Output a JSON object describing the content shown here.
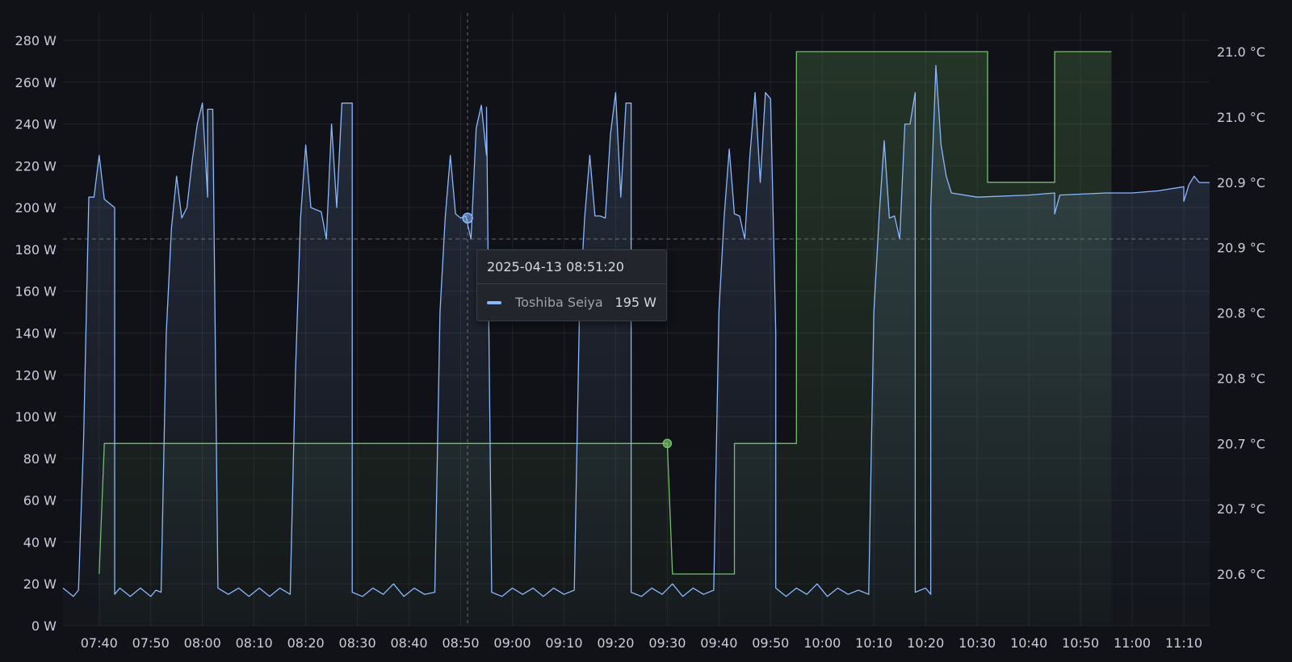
{
  "chart_data": {
    "type": "line",
    "title": "",
    "xlabel": "",
    "ylabel": "",
    "xlim_minutes": [
      "07:33",
      "11:15"
    ],
    "x_ticks": [
      "07:40",
      "07:50",
      "08:00",
      "08:10",
      "08:20",
      "08:30",
      "08:40",
      "08:50",
      "09:00",
      "09:10",
      "09:20",
      "09:30",
      "09:40",
      "09:50",
      "10:00",
      "10:10",
      "10:20",
      "10:30",
      "10:40",
      "10:50",
      "11:00",
      "11:10"
    ],
    "y_left": {
      "unit": "W",
      "range": [
        0,
        280
      ],
      "ticks": [
        "0 W",
        "20 W",
        "40 W",
        "60 W",
        "80 W",
        "100 W",
        "120 W",
        "140 W",
        "160 W",
        "180 W",
        "200 W",
        "220 W",
        "240 W",
        "260 W",
        "280 W"
      ]
    },
    "y_right": {
      "unit": "°C",
      "range": [
        20.55,
        21.0
      ],
      "ticks": [
        "20.6 °C",
        "20.7 °C",
        "20.7 °C",
        "20.8 °C",
        "20.8 °C",
        "20.9 °C",
        "20.9 °C",
        "21.0 °C",
        "21.0 °C"
      ]
    },
    "grid": true,
    "threshold_line_w": 185,
    "series": [
      {
        "name": "Toshiba Seiya",
        "axis": "left",
        "color": "#8ab8ff",
        "points": [
          [
            "07:33",
            18
          ],
          [
            "07:35",
            14
          ],
          [
            "07:36",
            17
          ],
          [
            "07:37",
            90
          ],
          [
            "07:38",
            205
          ],
          [
            "07:39",
            205
          ],
          [
            "07:40",
            225
          ],
          [
            "07:41",
            204
          ],
          [
            "07:42",
            202
          ],
          [
            "07:43",
            200
          ],
          [
            "07:43",
            15
          ],
          [
            "07:44",
            18
          ],
          [
            "07:46",
            14
          ],
          [
            "07:48",
            18
          ],
          [
            "07:50",
            14
          ],
          [
            "07:51",
            17
          ],
          [
            "07:52",
            16
          ],
          [
            "07:53",
            140
          ],
          [
            "07:54",
            190
          ],
          [
            "07:55",
            215
          ],
          [
            "07:56",
            195
          ],
          [
            "07:57",
            200
          ],
          [
            "07:58",
            222
          ],
          [
            "07:59",
            240
          ],
          [
            "08:00",
            250
          ],
          [
            "08:01",
            205
          ],
          [
            "08:01",
            247
          ],
          [
            "08:02",
            247
          ],
          [
            "08:03",
            18
          ],
          [
            "08:05",
            15
          ],
          [
            "08:07",
            18
          ],
          [
            "08:09",
            14
          ],
          [
            "08:11",
            18
          ],
          [
            "08:13",
            14
          ],
          [
            "08:15",
            18
          ],
          [
            "08:17",
            15
          ],
          [
            "08:18",
            120
          ],
          [
            "08:19",
            195
          ],
          [
            "08:20",
            230
          ],
          [
            "08:21",
            200
          ],
          [
            "08:23",
            198
          ],
          [
            "08:24",
            185
          ],
          [
            "08:25",
            240
          ],
          [
            "08:26",
            200
          ],
          [
            "08:27",
            250
          ],
          [
            "08:29",
            250
          ],
          [
            "08:29",
            16
          ],
          [
            "08:31",
            14
          ],
          [
            "08:33",
            18
          ],
          [
            "08:35",
            15
          ],
          [
            "08:37",
            20
          ],
          [
            "08:39",
            14
          ],
          [
            "08:41",
            18
          ],
          [
            "08:43",
            15
          ],
          [
            "08:45",
            16
          ],
          [
            "08:46",
            150
          ],
          [
            "08:47",
            195
          ],
          [
            "08:48",
            225
          ],
          [
            "08:49",
            197
          ],
          [
            "08:50",
            195
          ],
          [
            "08:51",
            196
          ],
          [
            "08:52",
            185
          ],
          [
            "08:53",
            238
          ],
          [
            "08:54",
            249
          ],
          [
            "08:55",
            225
          ],
          [
            "08:55",
            248
          ],
          [
            "08:56",
            16
          ],
          [
            "08:58",
            14
          ],
          [
            "09:00",
            18
          ],
          [
            "09:02",
            15
          ],
          [
            "09:04",
            18
          ],
          [
            "09:06",
            14
          ],
          [
            "09:08",
            18
          ],
          [
            "09:10",
            15
          ],
          [
            "09:12",
            17
          ],
          [
            "09:13",
            150
          ],
          [
            "09:14",
            195
          ],
          [
            "09:15",
            225
          ],
          [
            "09:16",
            196
          ],
          [
            "09:17",
            196
          ],
          [
            "09:18",
            195
          ],
          [
            "09:19",
            235
          ],
          [
            "09:20",
            255
          ],
          [
            "09:21",
            205
          ],
          [
            "09:22",
            250
          ],
          [
            "09:23",
            250
          ],
          [
            "09:23",
            16
          ],
          [
            "09:25",
            14
          ],
          [
            "09:27",
            18
          ],
          [
            "09:29",
            15
          ],
          [
            "09:31",
            20
          ],
          [
            "09:33",
            14
          ],
          [
            "09:35",
            18
          ],
          [
            "09:37",
            15
          ],
          [
            "09:39",
            17
          ],
          [
            "09:40",
            150
          ],
          [
            "09:41",
            195
          ],
          [
            "09:42",
            228
          ],
          [
            "09:43",
            197
          ],
          [
            "09:44",
            196
          ],
          [
            "09:45",
            185
          ],
          [
            "09:46",
            225
          ],
          [
            "09:47",
            255
          ],
          [
            "09:48",
            212
          ],
          [
            "09:49",
            255
          ],
          [
            "09:50",
            252
          ],
          [
            "09:51",
            140
          ],
          [
            "09:51",
            18
          ],
          [
            "09:53",
            14
          ],
          [
            "09:55",
            18
          ],
          [
            "09:57",
            15
          ],
          [
            "09:59",
            20
          ],
          [
            "10:01",
            14
          ],
          [
            "10:03",
            18
          ],
          [
            "10:05",
            15
          ],
          [
            "10:07",
            17
          ],
          [
            "10:09",
            15
          ],
          [
            "10:10",
            150
          ],
          [
            "10:11",
            195
          ],
          [
            "10:12",
            232
          ],
          [
            "10:13",
            195
          ],
          [
            "10:14",
            196
          ],
          [
            "10:15",
            185
          ],
          [
            "10:16",
            240
          ],
          [
            "10:17",
            240
          ],
          [
            "10:18",
            255
          ],
          [
            "10:18",
            16
          ],
          [
            "10:20",
            18
          ],
          [
            "10:21",
            15
          ],
          [
            "10:21",
            200
          ],
          [
            "10:22",
            268
          ],
          [
            "10:23",
            230
          ],
          [
            "10:24",
            215
          ],
          [
            "10:25",
            207
          ],
          [
            "10:30",
            205
          ],
          [
            "10:40",
            206
          ],
          [
            "10:45",
            207
          ],
          [
            "10:45",
            197
          ],
          [
            "10:46",
            206
          ],
          [
            "10:55",
            207
          ],
          [
            "11:00",
            207
          ],
          [
            "11:05",
            208
          ],
          [
            "11:10",
            210
          ],
          [
            "11:10",
            203
          ],
          [
            "11:11",
            211
          ],
          [
            "11:12",
            215
          ],
          [
            "11:13",
            212
          ],
          [
            "11:15",
            212
          ]
        ]
      },
      {
        "name": "",
        "axis": "right",
        "color": "#73bf69",
        "points": [
          [
            "07:40",
            20.6
          ],
          [
            "07:41",
            20.7
          ],
          [
            "09:30",
            20.7
          ],
          [
            "09:31",
            20.6
          ],
          [
            "09:43",
            20.6
          ],
          [
            "09:43",
            20.7
          ],
          [
            "09:55",
            20.7
          ],
          [
            "09:55",
            21.0
          ],
          [
            "10:32",
            21.0
          ],
          [
            "10:32",
            20.9
          ],
          [
            "10:45",
            20.9
          ],
          [
            "10:45",
            21.0
          ],
          [
            "10:56",
            21.0
          ]
        ]
      }
    ],
    "hover": {
      "time": "08:51:20",
      "value_w": 195
    }
  },
  "tooltip": {
    "timestamp": "2025-04-13 08:51:20",
    "series_name": "Toshiba Seiya",
    "value": "195 W",
    "swatch_color": "#8ab8ff"
  }
}
